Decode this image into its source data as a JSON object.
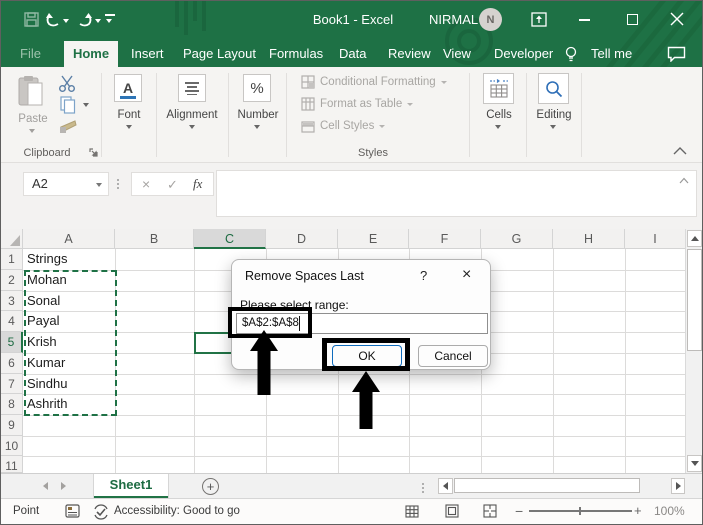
{
  "titlebar": {
    "title": "Book1 - Excel",
    "user": "NIRMAL",
    "avatar_initial": "N"
  },
  "tabs": {
    "items": [
      "File",
      "Home",
      "Insert",
      "Page Layout",
      "Formulas",
      "Data",
      "Review",
      "View",
      "Developer"
    ],
    "active": "Home",
    "tell_me": "Tell me"
  },
  "ribbon": {
    "clipboard": {
      "paste_label": "Paste",
      "group_label": "Clipboard"
    },
    "font": {
      "label": "Font",
      "glyph": "A"
    },
    "alignment": {
      "label": "Alignment"
    },
    "number": {
      "label": "Number",
      "glyph": "%"
    },
    "styles": {
      "items": [
        "Conditional Formatting",
        "Format as Table",
        "Cell Styles"
      ],
      "group_label": "Styles"
    },
    "cells": {
      "label": "Cells"
    },
    "editing": {
      "label": "Editing"
    }
  },
  "formula_bar": {
    "name_box": "A2",
    "cancel_glyph": "×",
    "enter_glyph": "✓",
    "fx_label": "fx",
    "value": ""
  },
  "grid": {
    "columns": [
      "A",
      "B",
      "C",
      "D",
      "E",
      "F",
      "G",
      "H",
      "I"
    ],
    "selected_column": "C",
    "rows": [
      1,
      2,
      3,
      4,
      5,
      6,
      7,
      8,
      9,
      10,
      11
    ],
    "selected_row": 5,
    "selected_range": "A2:A8",
    "active_cell": "C5",
    "column_a_values": [
      "Strings",
      "Mohan",
      "Sonal",
      "Payal",
      "Krish",
      "Kumar",
      "Sindhu",
      "Ashrith"
    ]
  },
  "dialog": {
    "title": "Remove Spaces Last",
    "help_glyph": "?",
    "close_glyph": "×",
    "prompt": "Please select range:",
    "range_value": "$A$2:$A$8",
    "ok_label": "OK",
    "cancel_label": "Cancel"
  },
  "sheet_bar": {
    "active_sheet": "Sheet1",
    "add_glyph": "+"
  },
  "status_bar": {
    "mode": "Point",
    "accessibility": "Accessibility: Good to go",
    "zoom_level": "100%"
  },
  "colors": {
    "excel_green": "#1e7145",
    "accent_green": "#217346",
    "ok_border": "#0f6cbd",
    "annotation": "#000000"
  }
}
